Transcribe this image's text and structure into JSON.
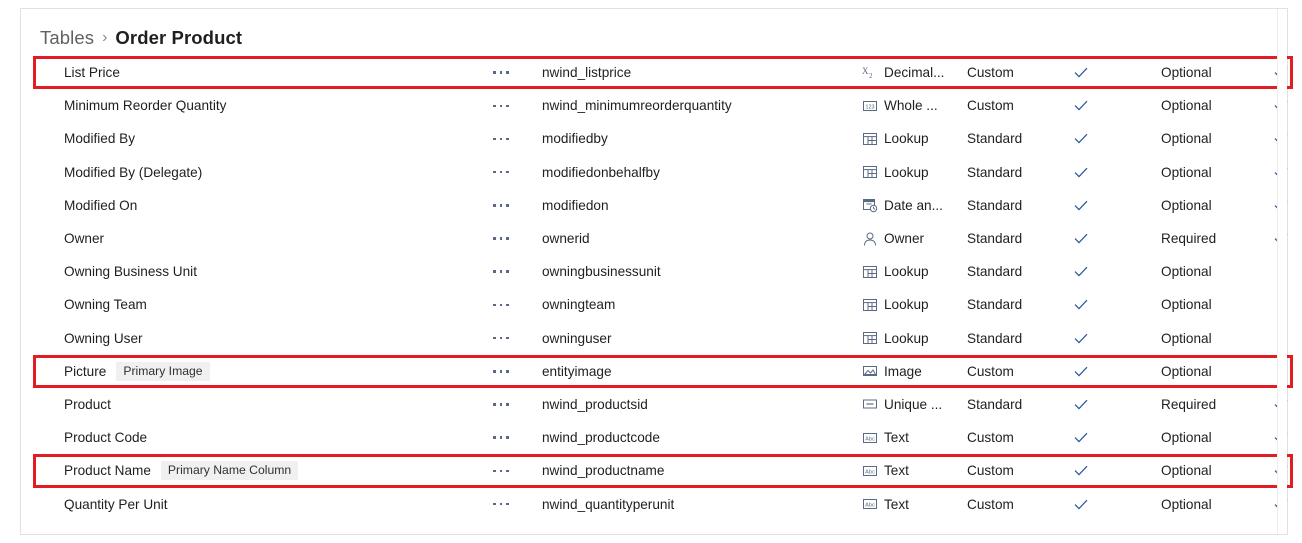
{
  "breadcrumb": {
    "root": "Tables",
    "separator": "›",
    "current": "Order Product"
  },
  "colors": {
    "highlight": "#e31b23",
    "text": "#201f1e",
    "muted": "#616161",
    "badge_bg": "#f0f0f0",
    "check": "#2b579a",
    "border": "#e1e1e1"
  },
  "icons": {
    "decimal": "decimal-number-icon",
    "whole": "whole-number-icon",
    "lookup": "lookup-icon",
    "datetime": "date-time-icon",
    "owner": "owner-person-icon",
    "image": "image-icon",
    "unique": "unique-identifier-icon",
    "text": "text-abc-icon",
    "check": "checkmark-icon",
    "more": "more-options-ellipsis-icon"
  },
  "grid": {
    "rows": [
      {
        "display_name": "List Price",
        "badge": "",
        "logical_name": "nwind_listprice",
        "data_type": "Decimal...",
        "type_icon": "decimal",
        "customization": "Custom",
        "check1": true,
        "requirement": "Optional",
        "check2": true,
        "highlighted": true
      },
      {
        "display_name": "Minimum Reorder Quantity",
        "badge": "",
        "logical_name": "nwind_minimumreorderquantity",
        "data_type": "Whole ...",
        "type_icon": "whole",
        "customization": "Custom",
        "check1": true,
        "requirement": "Optional",
        "check2": true,
        "highlighted": false
      },
      {
        "display_name": "Modified By",
        "badge": "",
        "logical_name": "modifiedby",
        "data_type": "Lookup",
        "type_icon": "lookup",
        "customization": "Standard",
        "check1": true,
        "requirement": "Optional",
        "check2": true,
        "highlighted": false
      },
      {
        "display_name": "Modified By (Delegate)",
        "badge": "",
        "logical_name": "modifiedonbehalfby",
        "data_type": "Lookup",
        "type_icon": "lookup",
        "customization": "Standard",
        "check1": true,
        "requirement": "Optional",
        "check2": true,
        "highlighted": false
      },
      {
        "display_name": "Modified On",
        "badge": "",
        "logical_name": "modifiedon",
        "data_type": "Date an...",
        "type_icon": "datetime",
        "customization": "Standard",
        "check1": true,
        "requirement": "Optional",
        "check2": true,
        "highlighted": false
      },
      {
        "display_name": "Owner",
        "badge": "",
        "logical_name": "ownerid",
        "data_type": "Owner",
        "type_icon": "owner",
        "customization": "Standard",
        "check1": true,
        "requirement": "Required",
        "check2": true,
        "highlighted": false
      },
      {
        "display_name": "Owning Business Unit",
        "badge": "",
        "logical_name": "owningbusinessunit",
        "data_type": "Lookup",
        "type_icon": "lookup",
        "customization": "Standard",
        "check1": true,
        "requirement": "Optional",
        "check2": false,
        "highlighted": false
      },
      {
        "display_name": "Owning Team",
        "badge": "",
        "logical_name": "owningteam",
        "data_type": "Lookup",
        "type_icon": "lookup",
        "customization": "Standard",
        "check1": true,
        "requirement": "Optional",
        "check2": false,
        "highlighted": false
      },
      {
        "display_name": "Owning User",
        "badge": "",
        "logical_name": "owninguser",
        "data_type": "Lookup",
        "type_icon": "lookup",
        "customization": "Standard",
        "check1": true,
        "requirement": "Optional",
        "check2": false,
        "highlighted": false
      },
      {
        "display_name": "Picture",
        "badge": "Primary Image",
        "logical_name": "entityimage",
        "data_type": "Image",
        "type_icon": "image",
        "customization": "Custom",
        "check1": true,
        "requirement": "Optional",
        "check2": false,
        "highlighted": true
      },
      {
        "display_name": "Product",
        "badge": "",
        "logical_name": "nwind_productsid",
        "data_type": "Unique ...",
        "type_icon": "unique",
        "customization": "Standard",
        "check1": true,
        "requirement": "Required",
        "check2": true,
        "highlighted": false
      },
      {
        "display_name": "Product Code",
        "badge": "",
        "logical_name": "nwind_productcode",
        "data_type": "Text",
        "type_icon": "text",
        "customization": "Custom",
        "check1": true,
        "requirement": "Optional",
        "check2": true,
        "highlighted": false
      },
      {
        "display_name": "Product Name",
        "badge": "Primary Name Column",
        "logical_name": "nwind_productname",
        "data_type": "Text",
        "type_icon": "text",
        "customization": "Custom",
        "check1": true,
        "requirement": "Optional",
        "check2": true,
        "highlighted": true
      },
      {
        "display_name": "Quantity Per Unit",
        "badge": "",
        "logical_name": "nwind_quantityperunit",
        "data_type": "Text",
        "type_icon": "text",
        "customization": "Custom",
        "check1": true,
        "requirement": "Optional",
        "check2": true,
        "highlighted": false
      }
    ]
  }
}
